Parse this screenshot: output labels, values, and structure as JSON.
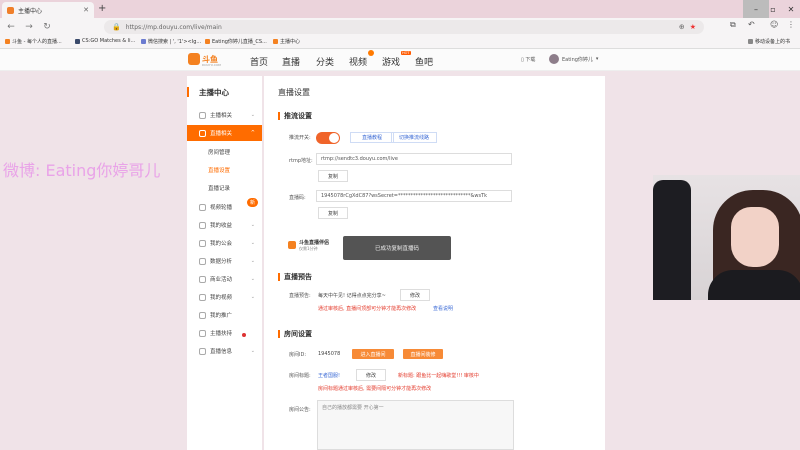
{
  "browser": {
    "tab_title": "主播中心",
    "url": "https://mp.douyu.com/live/main",
    "bookmarks": [
      "斗鱼 - 每个人的直播...",
      "CS:GO Matches & li...",
      "微信搜索 | ', '1'><Ig...",
      "Eating你婷儿直播_CS...",
      "主播中心"
    ],
    "right_bookmark": "移动设备上的书"
  },
  "site": {
    "logo_text": "斗鱼",
    "logo_sub": "DOUYU.COM",
    "nav": [
      "首页",
      "直播",
      "分类",
      "视频",
      "游戏",
      "鱼吧"
    ],
    "hot_badge": "HOT",
    "download": "下载",
    "username": "Eating你婷儿"
  },
  "sidebar": {
    "title": "主播中心",
    "items": [
      {
        "label": "主播相关"
      },
      {
        "label": "直播相关"
      },
      {
        "label": "房间管理"
      },
      {
        "label": "直播设置"
      },
      {
        "label": "直播记录"
      },
      {
        "label": "视频轮播"
      },
      {
        "label": "我的收益"
      },
      {
        "label": "我的公会"
      },
      {
        "label": "数据分析"
      },
      {
        "label": "商业活动"
      },
      {
        "label": "我的视频"
      },
      {
        "label": "我的推广"
      },
      {
        "label": "主播扶持"
      },
      {
        "label": "直播信息"
      }
    ],
    "new_tag": "新"
  },
  "main": {
    "title": "直播设置",
    "stream": {
      "section": "推流设置",
      "switch_label": "推流开关:",
      "link1": "直播教程",
      "link2": "切换推流线路",
      "rtmp_label": "rtmp地址:",
      "rtmp_value": "rtmp://sendtc3.douyu.com/live",
      "copy": "复制",
      "code_label": "直播码:",
      "code_value": "1945078rCgXdC87?wsSecret=*****************************&wsTk",
      "promo_title": "斗鱼直播伴侣",
      "promo_sub": "仅需1分钟"
    },
    "toast": "已成功复制直播码",
    "notice": {
      "section": "直播预告",
      "label": "直播预告:",
      "value": "每天中午见! 记得点点完分享~",
      "edit": "修改",
      "warn": "通过审核后, 直播间顶部可分钟才能再次修改",
      "link": "查看说明"
    },
    "room": {
      "section": "房间设置",
      "id_label": "房间ID:",
      "id_value": "1945078",
      "enter_btn": "进入直播间",
      "assist_btn": "直播间装修",
      "title_label": "房间标题:",
      "title_value": "王者国服!",
      "edit": "修改",
      "new_title": "新标题: 跟鱼比一起嗨歌堂!!!  审核中",
      "warn": "房间标题通过审核后, 需要间隔可分钟才能再次修改",
      "ann_label": "房间公告:",
      "ann_value": "自己的播放都需要 开心第一"
    }
  },
  "overlay": {
    "weibo": "微博: Eating你婷哥儿",
    "right_text": "移动设备上的书"
  }
}
